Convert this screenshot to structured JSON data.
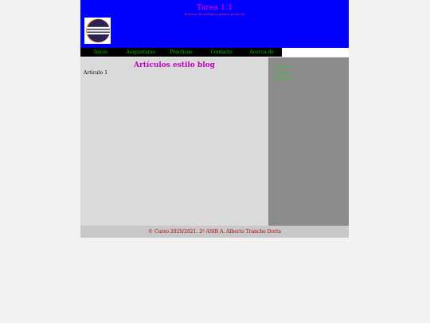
{
  "header": {
    "title": "Tarea 1.1",
    "subtitle": "Entorno de trabajo y primer proyecto",
    "logo_icon": "eclipse-logo-icon"
  },
  "nav": {
    "items": [
      {
        "label": "Inicio"
      },
      {
        "label": "Asignaturas"
      },
      {
        "label": "Prácticas"
      },
      {
        "label": "Contacto"
      },
      {
        "label": "Acerca de"
      }
    ]
  },
  "main": {
    "title": "Artículos estilo blog",
    "articles": [
      {
        "label": "Artículo 1"
      }
    ]
  },
  "sidebar": {
    "links": [
      {
        "label": "Enlace 1"
      },
      {
        "label": "Enlace 2"
      },
      {
        "label": "Enlace 3"
      }
    ]
  },
  "footer": {
    "text": "© Curso 2020/2021. 2º ASIR A. Alberto Trancho Dorta"
  },
  "colors": {
    "header_bg": "#0000ff",
    "title": "#ff00c8",
    "nav_bg": "#000000",
    "nav_text": "#00c800",
    "main_bg": "#dadada",
    "sidebar_bg": "#8c8c8c",
    "footer_bg": "#c8c8c8",
    "footer_text": "#b00000"
  }
}
